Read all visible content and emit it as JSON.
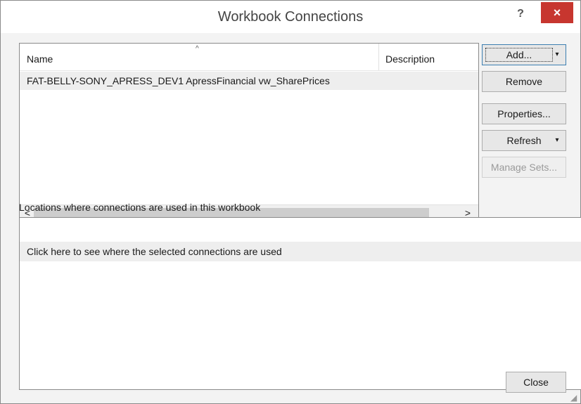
{
  "window": {
    "title": "Workbook Connections",
    "help": "?",
    "close": "×"
  },
  "connections_list": {
    "columns": {
      "name": "Name",
      "description": "Description"
    },
    "sort_indicator": "^",
    "rows": [
      {
        "name": "FAT-BELLY-SONY_APRESS_DEV1 ApressFinancial vw_SharePrices"
      }
    ],
    "scroll_left": "<",
    "scroll_right": ">"
  },
  "buttons": {
    "add": "Add...",
    "remove": "Remove",
    "properties": "Properties...",
    "refresh": "Refresh",
    "manage_sets": "Manage Sets...",
    "close": "Close",
    "dropdown_caret": "▾"
  },
  "locations": {
    "label": "Locations where connections are used in this workbook",
    "message": "Click here to see where the selected connections are used"
  },
  "colors": {
    "close_button": "#c7362f",
    "selected_row": "#eeeeee"
  }
}
